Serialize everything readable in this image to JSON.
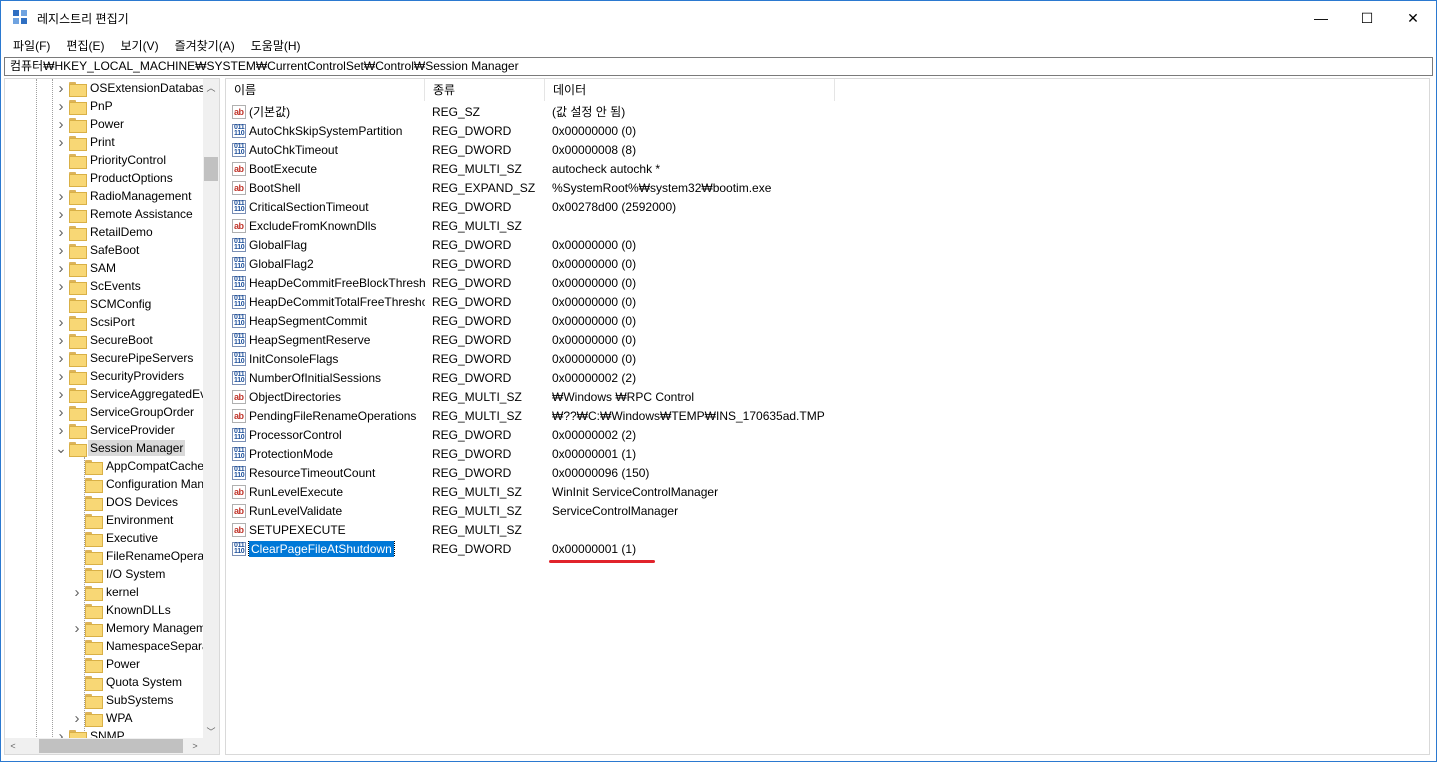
{
  "window": {
    "title": "레지스트리 편집기",
    "minimize": "—",
    "maximize": "☐",
    "close": "✕"
  },
  "menu": [
    "파일(F)",
    "편집(E)",
    "보기(V)",
    "즐겨찾기(A)",
    "도움말(H)"
  ],
  "address": "컴퓨터₩HKEY_LOCAL_MACHINE₩SYSTEM₩CurrentControlSet₩Control₩Session Manager",
  "tree": [
    {
      "label": "OSExtensionDatabase",
      "level": 1,
      "chevron": "right",
      "selected": false
    },
    {
      "label": "PnP",
      "level": 1,
      "chevron": "right",
      "selected": false
    },
    {
      "label": "Power",
      "level": 1,
      "chevron": "right",
      "selected": false
    },
    {
      "label": "Print",
      "level": 1,
      "chevron": "right",
      "selected": false
    },
    {
      "label": "PriorityControl",
      "level": 1,
      "chevron": "none",
      "selected": false
    },
    {
      "label": "ProductOptions",
      "level": 1,
      "chevron": "none",
      "selected": false
    },
    {
      "label": "RadioManagement",
      "level": 1,
      "chevron": "right",
      "selected": false
    },
    {
      "label": "Remote Assistance",
      "level": 1,
      "chevron": "right",
      "selected": false
    },
    {
      "label": "RetailDemo",
      "level": 1,
      "chevron": "right",
      "selected": false
    },
    {
      "label": "SafeBoot",
      "level": 1,
      "chevron": "right",
      "selected": false
    },
    {
      "label": "SAM",
      "level": 1,
      "chevron": "right",
      "selected": false
    },
    {
      "label": "ScEvents",
      "level": 1,
      "chevron": "right",
      "selected": false
    },
    {
      "label": "SCMConfig",
      "level": 1,
      "chevron": "none",
      "selected": false
    },
    {
      "label": "ScsiPort",
      "level": 1,
      "chevron": "right",
      "selected": false
    },
    {
      "label": "SecureBoot",
      "level": 1,
      "chevron": "right",
      "selected": false
    },
    {
      "label": "SecurePipeServers",
      "level": 1,
      "chevron": "right",
      "selected": false
    },
    {
      "label": "SecurityProviders",
      "level": 1,
      "chevron": "right",
      "selected": false
    },
    {
      "label": "ServiceAggregatedEvents",
      "level": 1,
      "chevron": "right",
      "selected": false
    },
    {
      "label": "ServiceGroupOrder",
      "level": 1,
      "chevron": "right",
      "selected": false
    },
    {
      "label": "ServiceProvider",
      "level": 1,
      "chevron": "right",
      "selected": false
    },
    {
      "label": "Session Manager",
      "level": 1,
      "chevron": "down",
      "selected": true
    },
    {
      "label": "AppCompatCache",
      "level": 2,
      "chevron": "none",
      "selected": false
    },
    {
      "label": "Configuration Manager",
      "level": 2,
      "chevron": "none",
      "selected": false
    },
    {
      "label": "DOS Devices",
      "level": 2,
      "chevron": "none",
      "selected": false
    },
    {
      "label": "Environment",
      "level": 2,
      "chevron": "none",
      "selected": false
    },
    {
      "label": "Executive",
      "level": 2,
      "chevron": "none",
      "selected": false
    },
    {
      "label": "FileRenameOperations",
      "level": 2,
      "chevron": "none",
      "selected": false
    },
    {
      "label": "I/O System",
      "level": 2,
      "chevron": "none",
      "selected": false
    },
    {
      "label": "kernel",
      "level": 2,
      "chevron": "right",
      "selected": false
    },
    {
      "label": "KnownDLLs",
      "level": 2,
      "chevron": "none",
      "selected": false
    },
    {
      "label": "Memory Management",
      "level": 2,
      "chevron": "right",
      "selected": false
    },
    {
      "label": "NamespaceSeparation",
      "level": 2,
      "chevron": "none",
      "selected": false
    },
    {
      "label": "Power",
      "level": 2,
      "chevron": "none",
      "selected": false
    },
    {
      "label": "Quota System",
      "level": 2,
      "chevron": "none",
      "selected": false
    },
    {
      "label": "SubSystems",
      "level": 2,
      "chevron": "none",
      "selected": false
    },
    {
      "label": "WPA",
      "level": 2,
      "chevron": "right",
      "selected": false
    },
    {
      "label": "SNMP",
      "level": 1,
      "chevron": "right",
      "selected": false
    }
  ],
  "columns": {
    "name": "이름",
    "type": "종류",
    "data": "데이터"
  },
  "values": [
    {
      "name": "(기본값)",
      "type": "REG_SZ",
      "data": "(값 설정 안 됨)",
      "icon": "string"
    },
    {
      "name": "AutoChkSkipSystemPartition",
      "type": "REG_DWORD",
      "data": "0x00000000 (0)",
      "icon": "binary"
    },
    {
      "name": "AutoChkTimeout",
      "type": "REG_DWORD",
      "data": "0x00000008 (8)",
      "icon": "binary"
    },
    {
      "name": "BootExecute",
      "type": "REG_MULTI_SZ",
      "data": "autocheck autochk *",
      "icon": "string"
    },
    {
      "name": "BootShell",
      "type": "REG_EXPAND_SZ",
      "data": "%SystemRoot%₩system32₩bootim.exe",
      "icon": "string"
    },
    {
      "name": "CriticalSectionTimeout",
      "type": "REG_DWORD",
      "data": "0x00278d00 (2592000)",
      "icon": "binary"
    },
    {
      "name": "ExcludeFromKnownDlls",
      "type": "REG_MULTI_SZ",
      "data": "",
      "icon": "string"
    },
    {
      "name": "GlobalFlag",
      "type": "REG_DWORD",
      "data": "0x00000000 (0)",
      "icon": "binary"
    },
    {
      "name": "GlobalFlag2",
      "type": "REG_DWORD",
      "data": "0x00000000 (0)",
      "icon": "binary"
    },
    {
      "name": "HeapDeCommitFreeBlockThreshold",
      "type": "REG_DWORD",
      "data": "0x00000000 (0)",
      "icon": "binary"
    },
    {
      "name": "HeapDeCommitTotalFreeThreshold",
      "type": "REG_DWORD",
      "data": "0x00000000 (0)",
      "icon": "binary"
    },
    {
      "name": "HeapSegmentCommit",
      "type": "REG_DWORD",
      "data": "0x00000000 (0)",
      "icon": "binary"
    },
    {
      "name": "HeapSegmentReserve",
      "type": "REG_DWORD",
      "data": "0x00000000 (0)",
      "icon": "binary"
    },
    {
      "name": "InitConsoleFlags",
      "type": "REG_DWORD",
      "data": "0x00000000 (0)",
      "icon": "binary"
    },
    {
      "name": "NumberOfInitialSessions",
      "type": "REG_DWORD",
      "data": "0x00000002 (2)",
      "icon": "binary"
    },
    {
      "name": "ObjectDirectories",
      "type": "REG_MULTI_SZ",
      "data": "₩Windows ₩RPC Control",
      "icon": "string"
    },
    {
      "name": "PendingFileRenameOperations",
      "type": "REG_MULTI_SZ",
      "data": "₩??₩C:₩Windows₩TEMP₩INS_170635ad.TMP",
      "icon": "string"
    },
    {
      "name": "ProcessorControl",
      "type": "REG_DWORD",
      "data": "0x00000002 (2)",
      "icon": "binary"
    },
    {
      "name": "ProtectionMode",
      "type": "REG_DWORD",
      "data": "0x00000001 (1)",
      "icon": "binary"
    },
    {
      "name": "ResourceTimeoutCount",
      "type": "REG_DWORD",
      "data": "0x00000096 (150)",
      "icon": "binary"
    },
    {
      "name": "RunLevelExecute",
      "type": "REG_MULTI_SZ",
      "data": "WinInit ServiceControlManager",
      "icon": "string"
    },
    {
      "name": "RunLevelValidate",
      "type": "REG_MULTI_SZ",
      "data": "ServiceControlManager",
      "icon": "string"
    },
    {
      "name": "SETUPEXECUTE",
      "type": "REG_MULTI_SZ",
      "data": "",
      "icon": "string"
    },
    {
      "name": "ClearPageFileAtShutdown",
      "type": "REG_DWORD",
      "data": "0x00000001 (1)",
      "icon": "binary",
      "selected": true
    }
  ],
  "icons": {
    "string": "ab",
    "binary": "011\n110"
  },
  "colors": {
    "selection": "#0078d7",
    "annotation": "#e1232b"
  }
}
